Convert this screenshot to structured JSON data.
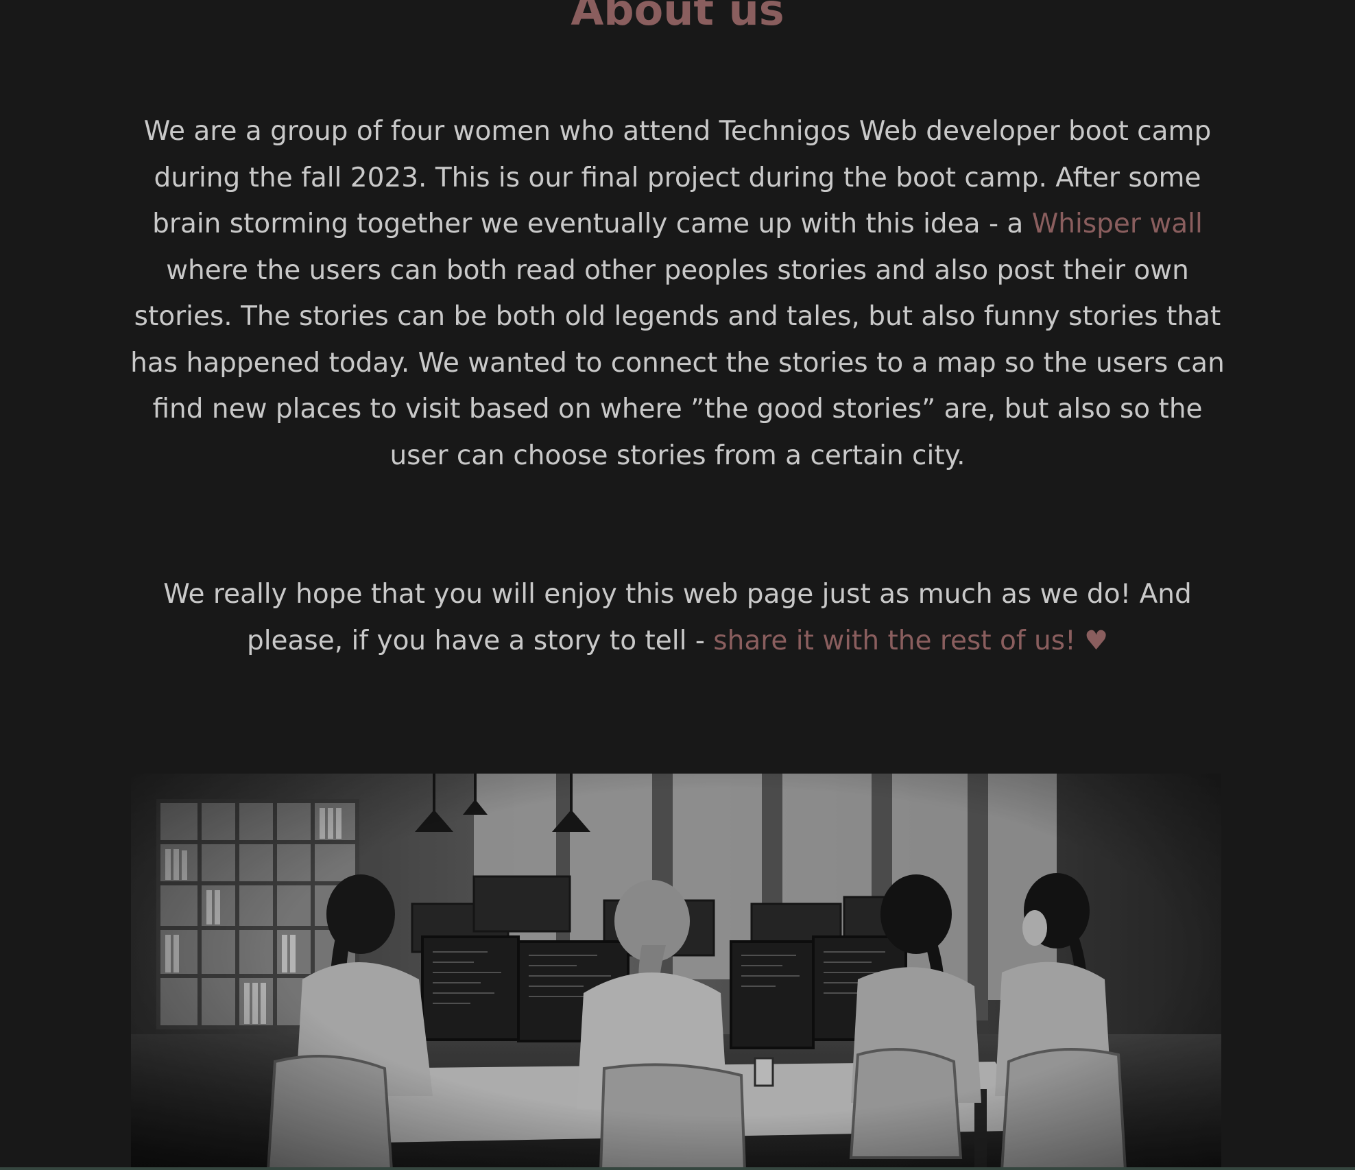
{
  "about": {
    "title": "About us",
    "intro": {
      "before_link": "We are a group of four women who attend Technigos Web developer boot camp during the fall 2023. This is our final project during the boot camp. After some brain storming together we eventually came up with this idea - a ",
      "link_text": "Whisper wall",
      "after_link": " where the users can both read other peoples stories and also post their own stories. The stories can be both old legends and tales, but also funny stories that has happened today. We wanted to connect the stories to a map so the users can find new places to visit based on where ”the good stories” are, but also so the user can choose stories from a certain city."
    },
    "outro": {
      "before_link": "We really hope that you will enjoy this web page just as much as we do! And please, if you have a story to tell - ",
      "link_text": "share it with the rest of us! ♥"
    },
    "image": {
      "icon": "office-coding-photo",
      "caption": ""
    }
  },
  "colors": {
    "background": "#181818",
    "accent": "#8a5e5e",
    "text": "#c9c9c9"
  }
}
